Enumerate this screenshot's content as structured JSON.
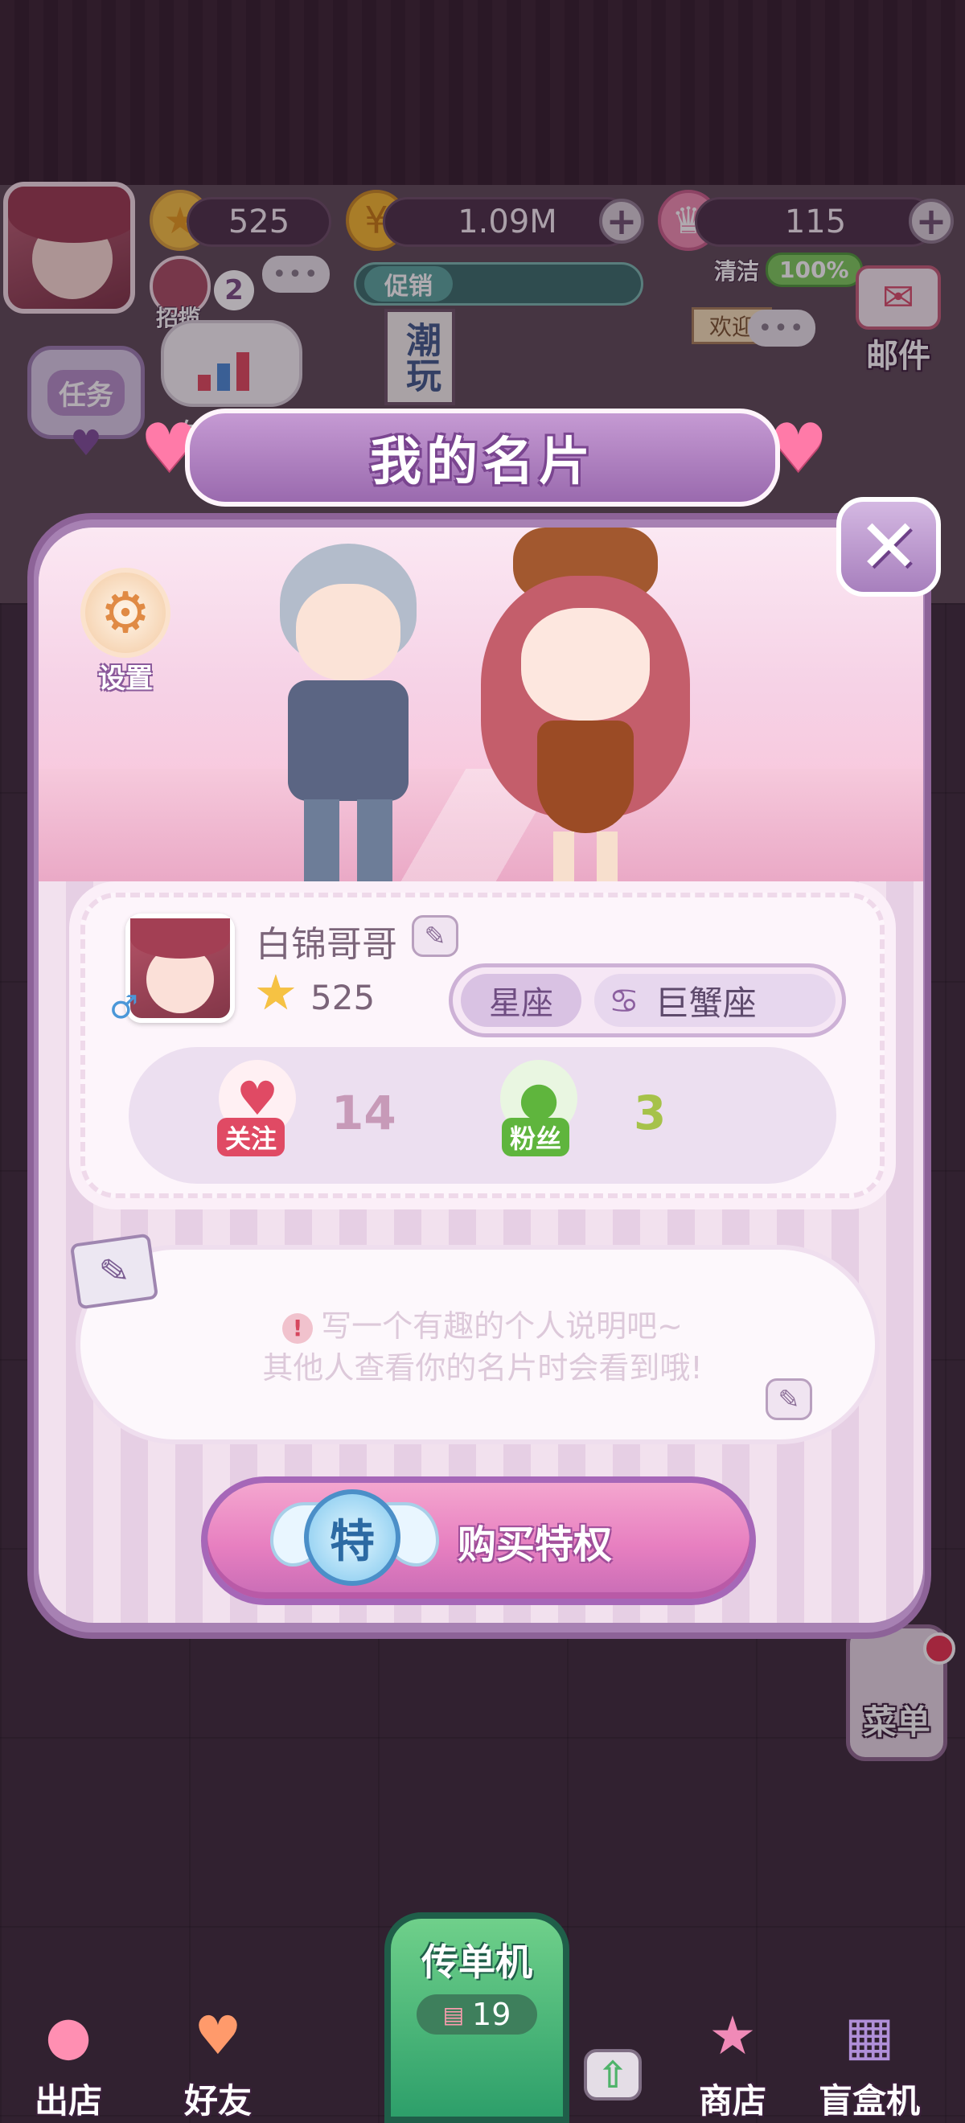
{
  "hud": {
    "stars": "525",
    "coins": "1.09M",
    "gems": "115",
    "promo_label": "促销",
    "clean_label": "清洁",
    "clean_value": "100%",
    "recruit_label": "招揽",
    "recruit_count": "2",
    "task_label": "任务",
    "shop_sign": "潮玩",
    "welcome_sign": "欢迎",
    "shop_owner_name": "白锦哥哥",
    "mail_label": "邮件",
    "menu_label": "菜单",
    "chat_dots": "•••"
  },
  "modal": {
    "title": "我的名片",
    "close_symbol": "✕",
    "settings_label": "设置",
    "profile": {
      "name": "白锦哥哥",
      "score": "525",
      "zodiac_tag": "星座",
      "zodiac_symbol": "♋",
      "zodiac_value": "巨蟹座",
      "follow_label": "关注",
      "follow_count": "14",
      "fans_label": "粉丝",
      "fans_count": "3"
    },
    "signature": {
      "line1": "写一个有趣的个人说明吧~",
      "line2": "其他人查看你的名片时会看到哦!",
      "warn_symbol": "!"
    },
    "buy_button": {
      "badge": "特",
      "label": "购买特权"
    }
  },
  "bottom_bar": {
    "exit_label": "出店",
    "friends_label": "好友",
    "flyer_label": "传单机",
    "flyer_count": "19",
    "shop_label": "商店",
    "blindbox_label": "盲盒机"
  },
  "colors": {
    "accent_purple": "#a781b3",
    "button_pink": "#e77fc0",
    "star_gold": "#f6c243",
    "follow_red": "#e04a64",
    "fans_green": "#5fb53d"
  }
}
